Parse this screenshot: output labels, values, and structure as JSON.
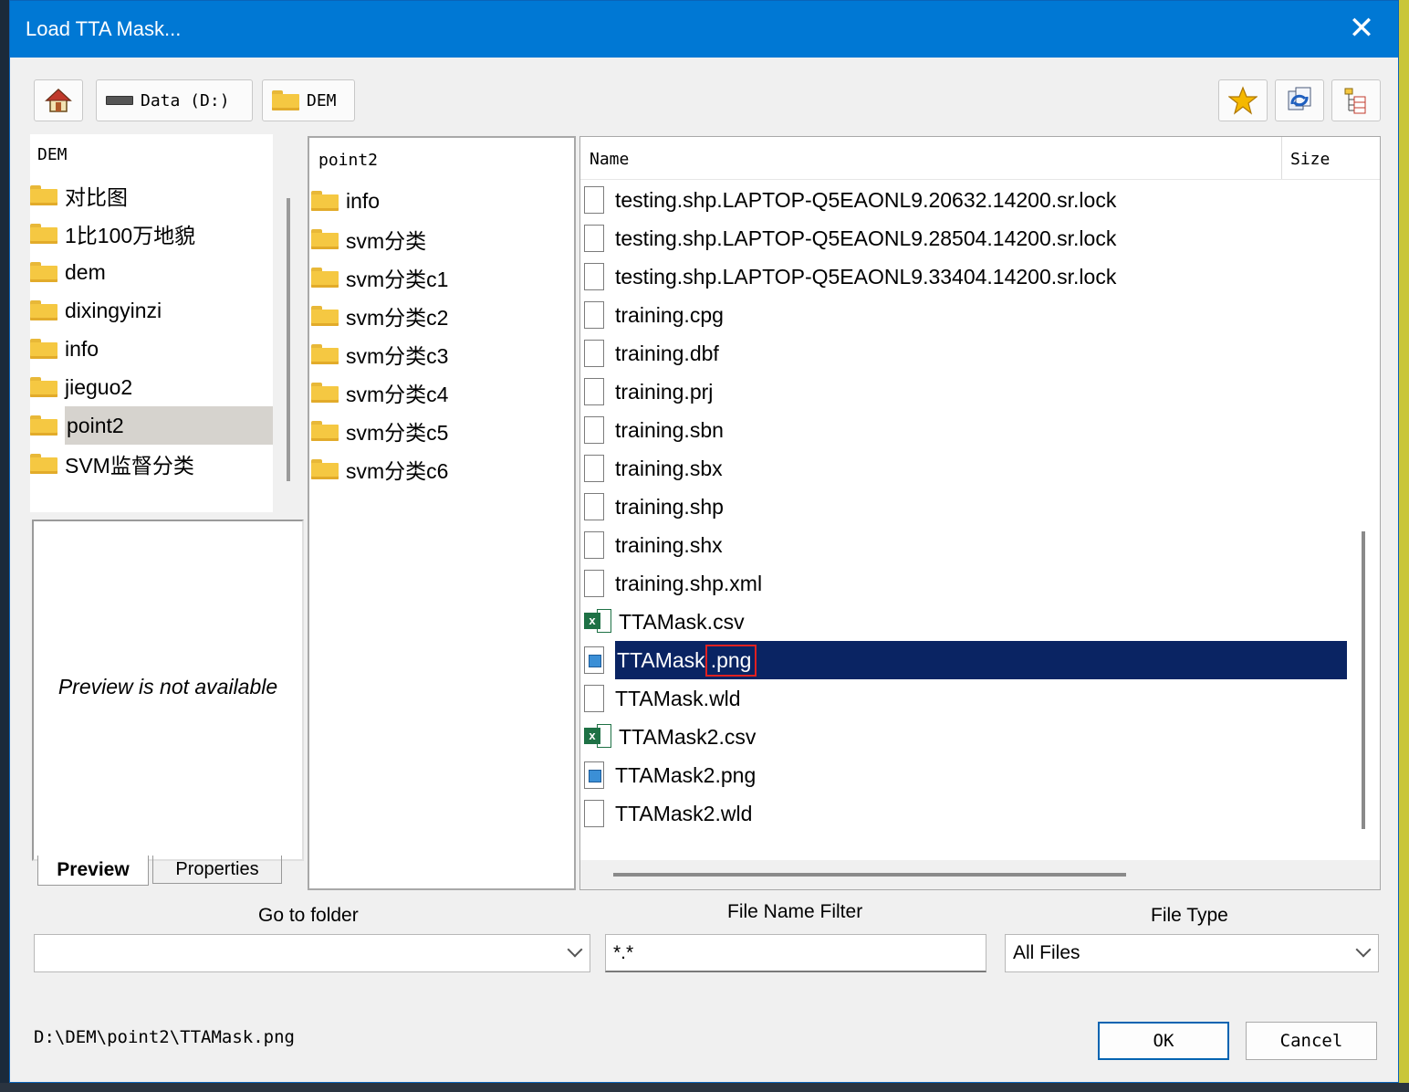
{
  "window": {
    "title": "Load TTA Mask...",
    "close_glyph": "✕"
  },
  "toolbar": {
    "breadcrumb": [
      {
        "label": "Data (D:)",
        "icon": "drive-icon"
      },
      {
        "label": "DEM",
        "icon": "folder-icon"
      }
    ],
    "icons": [
      "home-icon",
      "favorites-star-icon",
      "refresh-icon",
      "tree-view-icon"
    ]
  },
  "tree": {
    "header": "DEM",
    "items": [
      "对比图",
      "1比100万地貌",
      "dem",
      "dixingyinzi",
      "info",
      "jieguo2",
      "point2",
      "SVM监督分类"
    ],
    "selected": "point2"
  },
  "subfolders": {
    "header": "point2",
    "items": [
      "info",
      "svm分类",
      "svm分类c1",
      "svm分类c2",
      "svm分类c3",
      "svm分类c4",
      "svm分类c5",
      "svm分类c6"
    ]
  },
  "file_list": {
    "columns": [
      "Name",
      "Size"
    ],
    "files": [
      {
        "name": "testing.shp.LAPTOP-Q5EAONL9.20632.14200.sr.lock",
        "icon": "file-icon"
      },
      {
        "name": "testing.shp.LAPTOP-Q5EAONL9.28504.14200.sr.lock",
        "icon": "file-icon"
      },
      {
        "name": "testing.shp.LAPTOP-Q5EAONL9.33404.14200.sr.lock",
        "icon": "file-icon"
      },
      {
        "name": "training.cpg",
        "icon": "file-icon"
      },
      {
        "name": "training.dbf",
        "icon": "file-icon"
      },
      {
        "name": "training.prj",
        "icon": "file-icon"
      },
      {
        "name": "training.sbn",
        "icon": "file-icon"
      },
      {
        "name": "training.sbx",
        "icon": "file-icon"
      },
      {
        "name": "training.shp",
        "icon": "file-icon"
      },
      {
        "name": "training.shx",
        "icon": "file-icon"
      },
      {
        "name": "training.shp.xml",
        "icon": "file-icon"
      },
      {
        "name": "TTAMask.csv",
        "icon": "excel-icon"
      },
      {
        "name": "TTAMask.png",
        "icon": "image-file-icon",
        "selected": true,
        "name_base": "TTAMask",
        "name_ext": ".png"
      },
      {
        "name": "TTAMask.wld",
        "icon": "file-icon"
      },
      {
        "name": "TTAMask2.csv",
        "icon": "excel-icon"
      },
      {
        "name": "TTAMask2.png",
        "icon": "image-file-icon"
      },
      {
        "name": "TTAMask2.wld",
        "icon": "file-icon"
      }
    ]
  },
  "preview": {
    "message": "Preview is not available",
    "tabs": [
      "Preview",
      "Properties"
    ],
    "active_tab": "Preview"
  },
  "filters": {
    "go_to_folder_label": "Go to folder",
    "go_to_folder_value": "",
    "name_filter_label": "File Name Filter",
    "name_filter_value": "*.*",
    "file_type_label": "File Type",
    "file_type_value": "All Files"
  },
  "status_path": "D:\\DEM\\point2\\TTAMask.png",
  "buttons": {
    "ok": "OK",
    "cancel": "Cancel"
  },
  "colors": {
    "titlebar": "#0078d4",
    "selection": "#0a2463",
    "highlight_box": "#e02020"
  }
}
